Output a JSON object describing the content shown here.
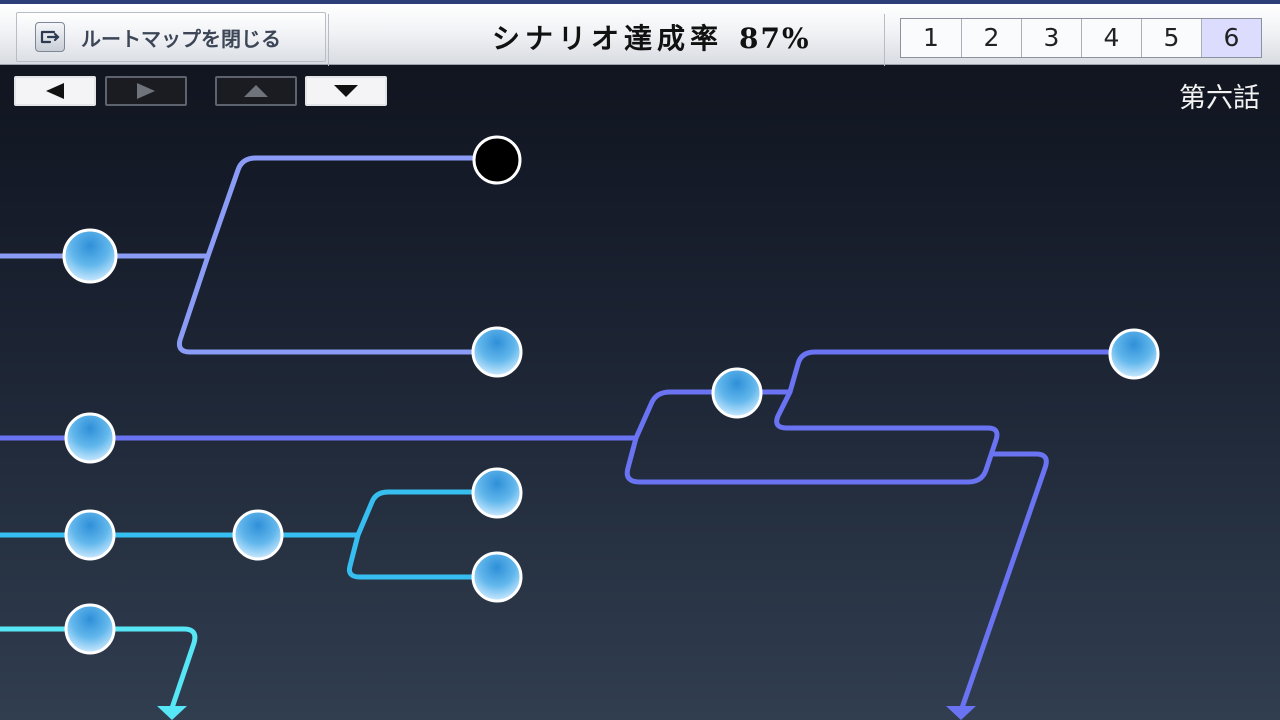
{
  "header": {
    "close_button_label": "ルートマップを閉じる",
    "close_icon": "route-map-icon",
    "completion_label": "シナリオ達成率",
    "completion_value": "87%",
    "chapters": [
      {
        "label": "1",
        "active": false
      },
      {
        "label": "2",
        "active": false
      },
      {
        "label": "3",
        "active": false
      },
      {
        "label": "4",
        "active": false
      },
      {
        "label": "5",
        "active": false
      },
      {
        "label": "6",
        "active": true
      }
    ]
  },
  "navigation": {
    "left": {
      "icon": "arrow-left-icon",
      "enabled": true
    },
    "right": {
      "icon": "arrow-right-icon",
      "enabled": false
    },
    "up": {
      "icon": "arrow-up-icon",
      "enabled": false
    },
    "down": {
      "icon": "arrow-down-icon",
      "enabled": true
    }
  },
  "episode_title": "第六話",
  "route_colors": {
    "periwinkle": "#8a9cf6",
    "indigo": "#6a74f2",
    "sky": "#36bef0",
    "cyan": "#56e6f6",
    "unvisited_node": "#000000",
    "node_fill": "#59b4ea",
    "node_ring": "#ffffff"
  }
}
